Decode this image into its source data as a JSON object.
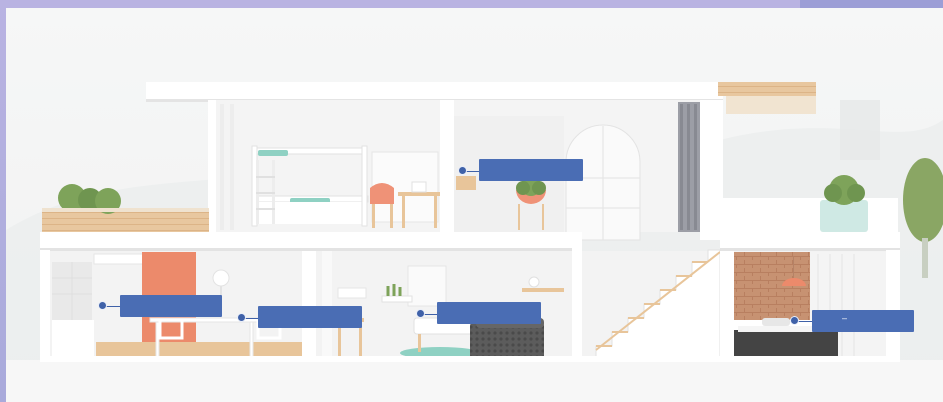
{
  "scene": {
    "subject": "house-cross-section",
    "colors": {
      "frame_left": "#b3b1dd",
      "frame_right": "#9fa0d6",
      "backdrop": "#f1f2f2",
      "wall": "#ffffff",
      "floor_slab": "#f6f6f6",
      "wood": "#e8c59a",
      "accent_panel": "#ec8a6b",
      "brick": "#c98d6b",
      "teal": "#8fd1c3",
      "plant": "#7ea35a",
      "sofa_grey": "#585858",
      "callout": "#4a6db4"
    }
  },
  "callouts": [
    {
      "id": "bunk-room",
      "text": ""
    },
    {
      "id": "kitchen-sink",
      "text": ""
    },
    {
      "id": "dining",
      "text": ""
    },
    {
      "id": "living-room",
      "text": ""
    },
    {
      "id": "bedroom",
      "text": "–"
    }
  ]
}
